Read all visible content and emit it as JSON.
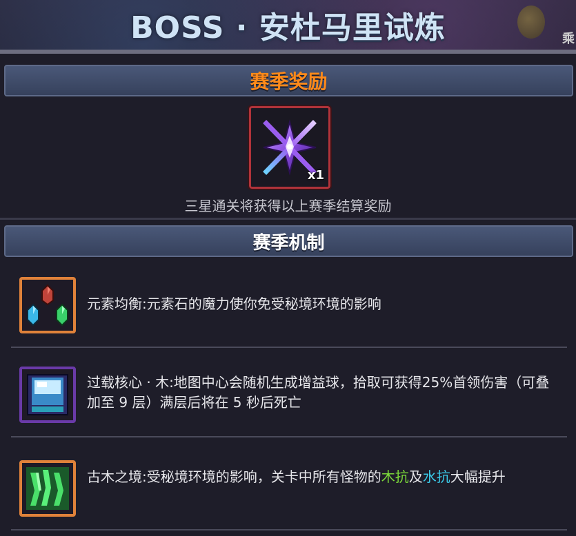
{
  "title": "BOSS · 安杜马里试炼",
  "corner_text": "乘",
  "season_reward": {
    "header": "赛季奖励",
    "item_count": "x1",
    "item_icon": "purple-shuriken-icon",
    "description": "三星通关将获得以上赛季结算奖励"
  },
  "season_mechanics": {
    "header": "赛季机制",
    "items": [
      {
        "icon": "element-stones-icon",
        "frame_color": "#e0823a",
        "text": "元素均衡:元素石的魔力使你免受秘境环境的影响"
      },
      {
        "icon": "overload-core-icon",
        "frame_color": "#6a3aa8",
        "text": "过载核心 · 木:地图中心会随机生成增益球，拾取可获得25%首领伤害（可叠加至 9 层）满层后将在 5 秒后死亡"
      },
      {
        "icon": "ancient-wood-icon",
        "frame_color": "#e0823a",
        "text_before": "古木之境:受秘境环境的影响，关卡中所有怪物的",
        "highlight_1": "木抗",
        "text_mid": "及",
        "highlight_2": "水抗",
        "text_after": "大幅提升"
      }
    ]
  },
  "colors": {
    "reward_header": "#ff8a1a",
    "wood_resist": "#7ddc3a",
    "water_resist": "#3ac8e6"
  }
}
